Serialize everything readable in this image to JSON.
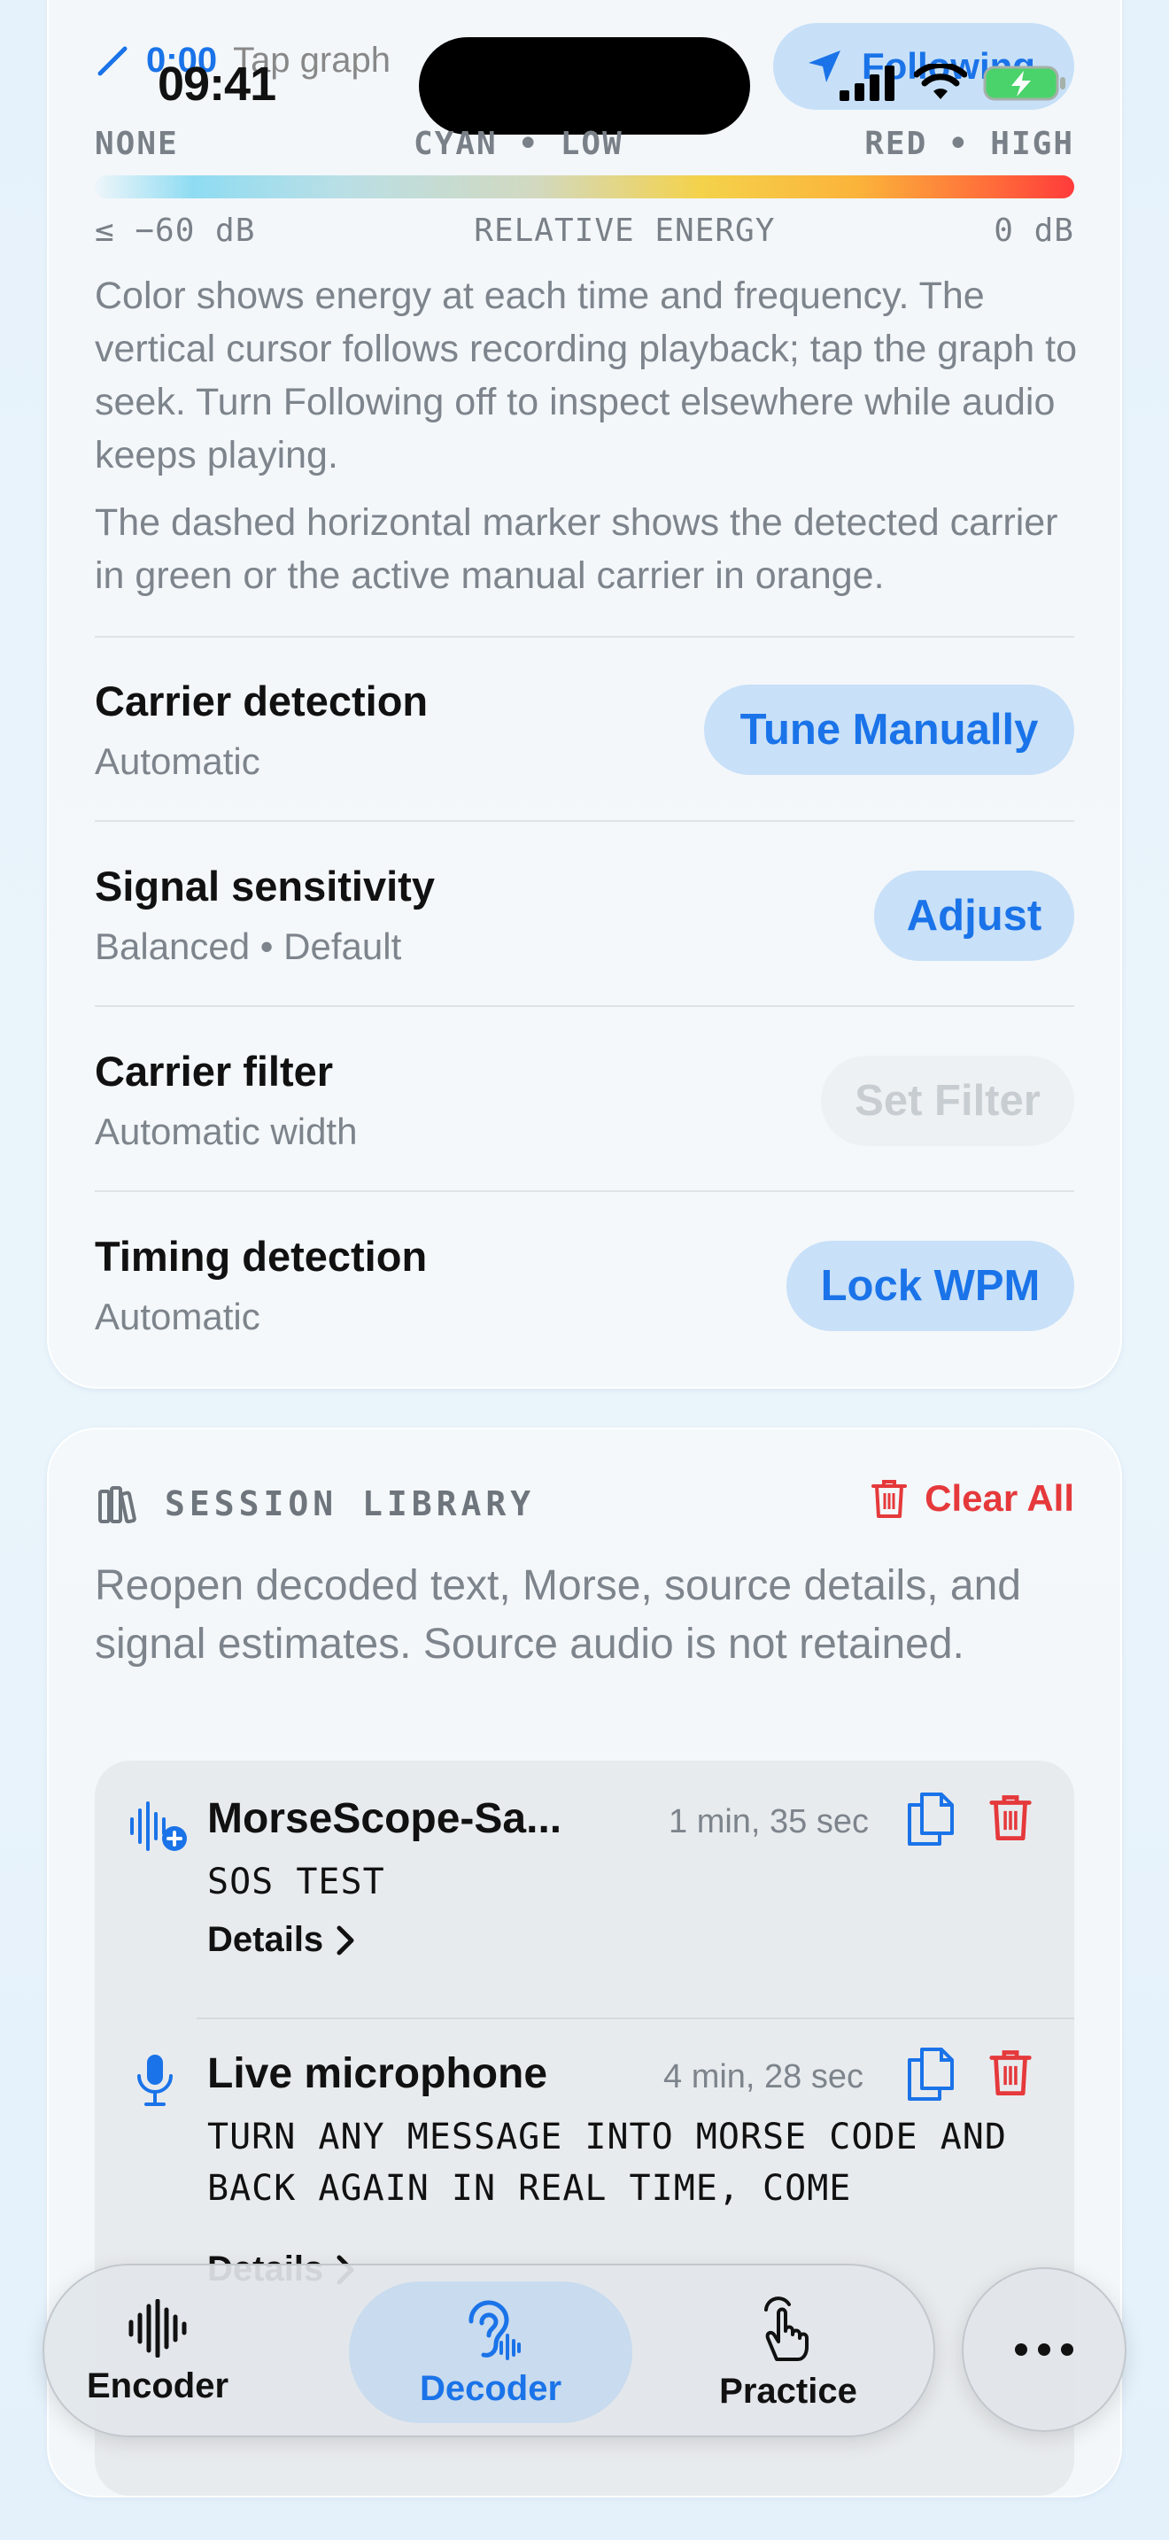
{
  "status": {
    "time": "09:41"
  },
  "top": {
    "time": "0:00",
    "tap_hint": "Tap graph",
    "following_label": "Following"
  },
  "legend": {
    "none": "NONE",
    "cyan_low": "CYAN • LOW",
    "red_high": "RED • HIGH",
    "min_db": "≤ −60 dB",
    "axis_label": "RELATIVE ENERGY",
    "max_db": "0 dB"
  },
  "description": {
    "para1": "Color shows energy at each time and frequency. The vertical cursor follows recording playback; tap the graph to seek. Turn Following off to inspect elsewhere while audio keeps playing.",
    "para2": "The dashed horizontal marker shows the detected carrier in green or the active manual carrier in orange."
  },
  "settings": [
    {
      "title": "Carrier detection",
      "subtitle": "Automatic",
      "button": "Tune Manually"
    },
    {
      "title": "Signal sensitivity",
      "subtitle": "Balanced • Default",
      "button": "Adjust"
    },
    {
      "title": "Carrier filter",
      "subtitle": "Automatic width",
      "button": "Set Filter"
    },
    {
      "title": "Timing detection",
      "subtitle": "Automatic",
      "button": "Lock WPM"
    }
  ],
  "library": {
    "title": "SESSION LIBRARY",
    "clear_all": "Clear All",
    "description": "Reopen decoded text, Morse, source details, and signal estimates. Source audio is not retained.",
    "sessions": [
      {
        "icon": "waveform-add-icon",
        "title": "MorseScope-Sa...",
        "duration": "1 min, 35 sec",
        "text": "SOS TEST",
        "details": "Details"
      },
      {
        "icon": "microphone-icon",
        "title": "Live microphone",
        "duration": "4 min, 28 sec",
        "text": "TURN ANY MESSAGE INTO MORSE CODE AND BACK AGAIN IN REAL TIME, COME",
        "details": "Details"
      }
    ]
  },
  "tabs": [
    {
      "label": "Encoder",
      "icon": "waveform-icon"
    },
    {
      "label": "Decoder",
      "icon": "ear-icon"
    },
    {
      "label": "Practice",
      "icon": "hand-tap-icon"
    }
  ],
  "colors": {
    "accent": "#1a73e8",
    "destructive": "#e5393b",
    "pill_bg": "#c8e0f8"
  }
}
